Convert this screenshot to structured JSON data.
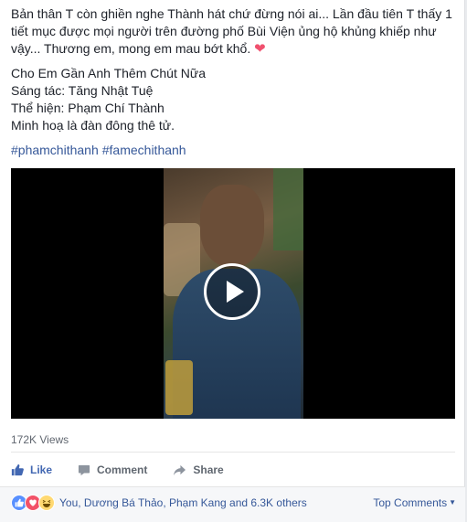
{
  "post": {
    "line1": "Bản thân T còn ghiền nghe Thành hát chứ đừng nói ai... Lần đầu tiên T thấy 1 tiết mục được mọi người trên đường phố Bùi Viện ủng hộ khủng khiếp như vậy... Thương em, mong em mau bớt khổ.",
    "song_title": "Cho Em Gần Anh Thêm Chút Nữa",
    "composer": "Sáng tác: Tăng Nhật Tuệ",
    "performer": "Thể hiện: Phạm Chí Thành",
    "illustration": "Minh hoạ là đàn đông thê tử.",
    "hashtags": [
      "#phamchithanh",
      "#famechithanh"
    ]
  },
  "video": {
    "views": "172K Views"
  },
  "actions": {
    "like": "Like",
    "comment": "Comment",
    "share": "Share"
  },
  "reactions": {
    "summary": "You, Dương Bá Thảo, Phạm Kang and 6.3K others",
    "sort_label": "Top Comments"
  },
  "colors": {
    "link": "#365899",
    "like_blue": "#4267b2",
    "love": "#f25268",
    "heart": "#f0506e"
  }
}
